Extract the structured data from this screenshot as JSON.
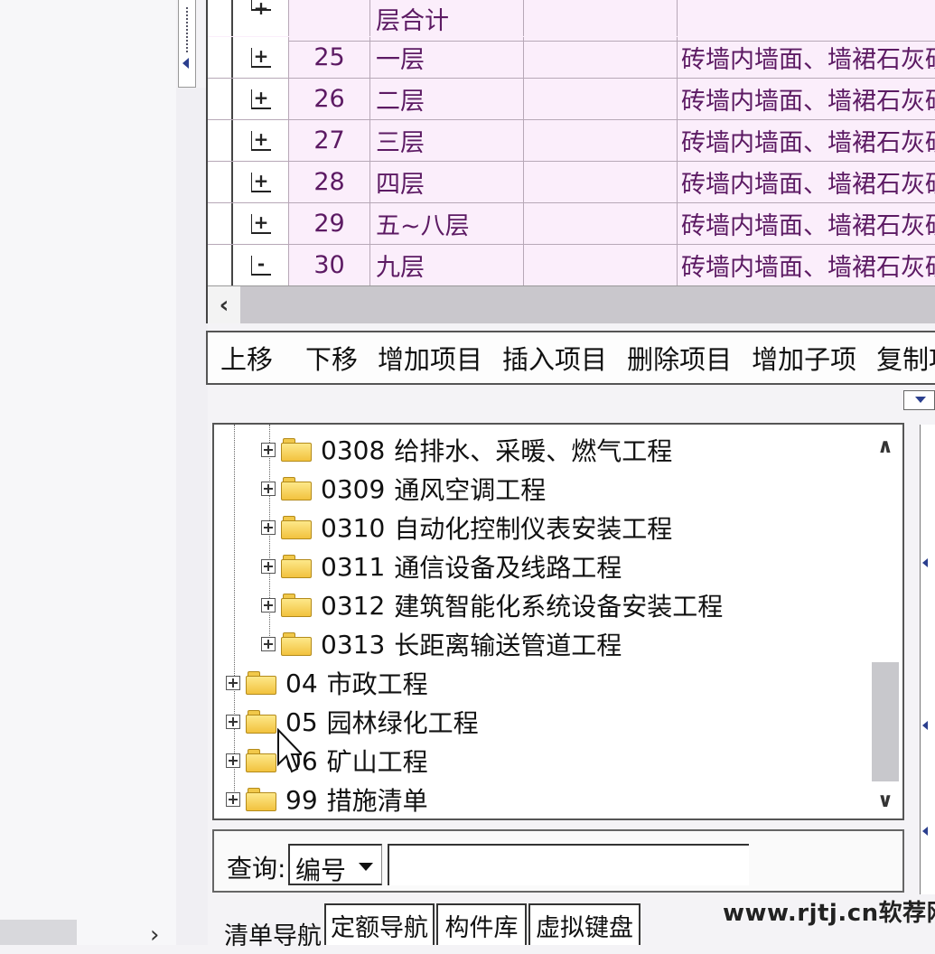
{
  "grid": {
    "partial_row": {
      "name": "层合计"
    },
    "rows": [
      {
        "num": "25",
        "name": "一层",
        "desc": "砖墙内墙面、墙裙石灰砂浆"
      },
      {
        "num": "26",
        "name": "二层",
        "desc": "砖墙内墙面、墙裙石灰砂浆"
      },
      {
        "num": "27",
        "name": "三层",
        "desc": "砖墙内墙面、墙裙石灰砂浆"
      },
      {
        "num": "28",
        "name": "四层",
        "desc": "砖墙内墙面、墙裙石灰砂浆"
      },
      {
        "num": "29",
        "name": "五~八层",
        "desc": "砖墙内墙面、墙裙石灰砂浆"
      },
      {
        "num": "30",
        "name": "九层",
        "desc": "砖墙内墙面、墙裙石灰砂浆"
      }
    ],
    "expand_signs": [
      "+",
      "+",
      "+",
      "+",
      "+",
      "+",
      "-"
    ]
  },
  "toolbar": {
    "move_up": "上移",
    "move_down": "下移",
    "add_item": "增加项目",
    "insert_item": "插入项目",
    "delete_item": "删除项目",
    "add_child": "增加子项",
    "copy_item": "复制项目"
  },
  "tree": {
    "children": [
      {
        "code": "0308",
        "name": "给排水、采暖、燃气工程"
      },
      {
        "code": "0309",
        "name": "通风空调工程"
      },
      {
        "code": "0310",
        "name": "自动化控制仪表安装工程"
      },
      {
        "code": "0311",
        "name": "通信设备及线路工程"
      },
      {
        "code": "0312",
        "name": "建筑智能化系统设备安装工程"
      },
      {
        "code": "0313",
        "name": "长距离输送管道工程"
      }
    ],
    "top": [
      {
        "code": "04",
        "name": "市政工程"
      },
      {
        "code": "05",
        "name": "园林绿化工程"
      },
      {
        "code": "06",
        "name": "矿山工程"
      },
      {
        "code": "99",
        "name": "措施清单"
      }
    ]
  },
  "query": {
    "label": "查询:",
    "field_value": "编号",
    "input_value": ""
  },
  "tabs": {
    "t1": "清单导航",
    "t2": "定额导航",
    "t3": "构件库",
    "t4": "虚拟键盘"
  },
  "watermark": "www.rjtj.cn软荐网",
  "colors": {
    "grid_bg": "#fbeefb",
    "grid_text": "#5c1a63",
    "folder": "#f2c23e"
  }
}
